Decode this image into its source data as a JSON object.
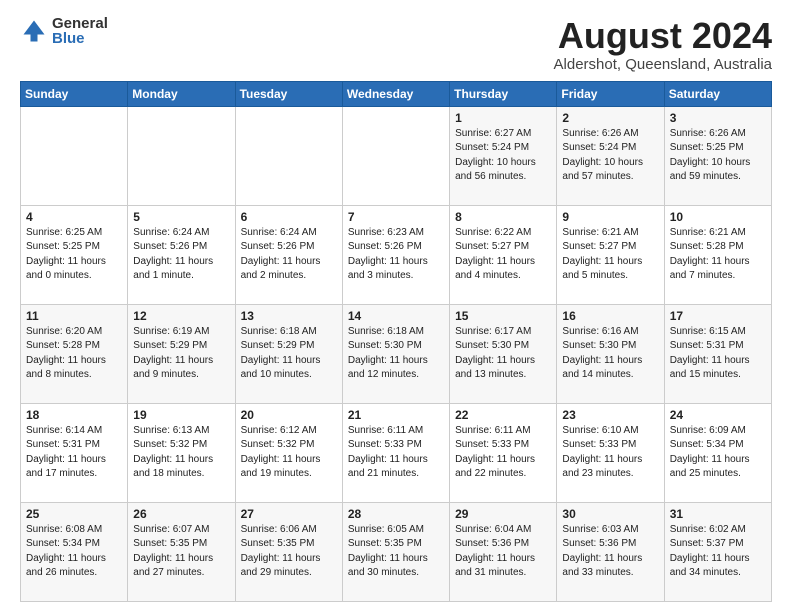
{
  "logo": {
    "general": "General",
    "blue": "Blue"
  },
  "header": {
    "month": "August 2024",
    "location": "Aldershot, Queensland, Australia"
  },
  "weekdays": [
    "Sunday",
    "Monday",
    "Tuesday",
    "Wednesday",
    "Thursday",
    "Friday",
    "Saturday"
  ],
  "rows": [
    [
      {
        "day": "",
        "info": ""
      },
      {
        "day": "",
        "info": ""
      },
      {
        "day": "",
        "info": ""
      },
      {
        "day": "",
        "info": ""
      },
      {
        "day": "1",
        "info": "Sunrise: 6:27 AM\nSunset: 5:24 PM\nDaylight: 10 hours\nand 56 minutes."
      },
      {
        "day": "2",
        "info": "Sunrise: 6:26 AM\nSunset: 5:24 PM\nDaylight: 10 hours\nand 57 minutes."
      },
      {
        "day": "3",
        "info": "Sunrise: 6:26 AM\nSunset: 5:25 PM\nDaylight: 10 hours\nand 59 minutes."
      }
    ],
    [
      {
        "day": "4",
        "info": "Sunrise: 6:25 AM\nSunset: 5:25 PM\nDaylight: 11 hours\nand 0 minutes."
      },
      {
        "day": "5",
        "info": "Sunrise: 6:24 AM\nSunset: 5:26 PM\nDaylight: 11 hours\nand 1 minute."
      },
      {
        "day": "6",
        "info": "Sunrise: 6:24 AM\nSunset: 5:26 PM\nDaylight: 11 hours\nand 2 minutes."
      },
      {
        "day": "7",
        "info": "Sunrise: 6:23 AM\nSunset: 5:26 PM\nDaylight: 11 hours\nand 3 minutes."
      },
      {
        "day": "8",
        "info": "Sunrise: 6:22 AM\nSunset: 5:27 PM\nDaylight: 11 hours\nand 4 minutes."
      },
      {
        "day": "9",
        "info": "Sunrise: 6:21 AM\nSunset: 5:27 PM\nDaylight: 11 hours\nand 5 minutes."
      },
      {
        "day": "10",
        "info": "Sunrise: 6:21 AM\nSunset: 5:28 PM\nDaylight: 11 hours\nand 7 minutes."
      }
    ],
    [
      {
        "day": "11",
        "info": "Sunrise: 6:20 AM\nSunset: 5:28 PM\nDaylight: 11 hours\nand 8 minutes."
      },
      {
        "day": "12",
        "info": "Sunrise: 6:19 AM\nSunset: 5:29 PM\nDaylight: 11 hours\nand 9 minutes."
      },
      {
        "day": "13",
        "info": "Sunrise: 6:18 AM\nSunset: 5:29 PM\nDaylight: 11 hours\nand 10 minutes."
      },
      {
        "day": "14",
        "info": "Sunrise: 6:18 AM\nSunset: 5:30 PM\nDaylight: 11 hours\nand 12 minutes."
      },
      {
        "day": "15",
        "info": "Sunrise: 6:17 AM\nSunset: 5:30 PM\nDaylight: 11 hours\nand 13 minutes."
      },
      {
        "day": "16",
        "info": "Sunrise: 6:16 AM\nSunset: 5:30 PM\nDaylight: 11 hours\nand 14 minutes."
      },
      {
        "day": "17",
        "info": "Sunrise: 6:15 AM\nSunset: 5:31 PM\nDaylight: 11 hours\nand 15 minutes."
      }
    ],
    [
      {
        "day": "18",
        "info": "Sunrise: 6:14 AM\nSunset: 5:31 PM\nDaylight: 11 hours\nand 17 minutes."
      },
      {
        "day": "19",
        "info": "Sunrise: 6:13 AM\nSunset: 5:32 PM\nDaylight: 11 hours\nand 18 minutes."
      },
      {
        "day": "20",
        "info": "Sunrise: 6:12 AM\nSunset: 5:32 PM\nDaylight: 11 hours\nand 19 minutes."
      },
      {
        "day": "21",
        "info": "Sunrise: 6:11 AM\nSunset: 5:33 PM\nDaylight: 11 hours\nand 21 minutes."
      },
      {
        "day": "22",
        "info": "Sunrise: 6:11 AM\nSunset: 5:33 PM\nDaylight: 11 hours\nand 22 minutes."
      },
      {
        "day": "23",
        "info": "Sunrise: 6:10 AM\nSunset: 5:33 PM\nDaylight: 11 hours\nand 23 minutes."
      },
      {
        "day": "24",
        "info": "Sunrise: 6:09 AM\nSunset: 5:34 PM\nDaylight: 11 hours\nand 25 minutes."
      }
    ],
    [
      {
        "day": "25",
        "info": "Sunrise: 6:08 AM\nSunset: 5:34 PM\nDaylight: 11 hours\nand 26 minutes."
      },
      {
        "day": "26",
        "info": "Sunrise: 6:07 AM\nSunset: 5:35 PM\nDaylight: 11 hours\nand 27 minutes."
      },
      {
        "day": "27",
        "info": "Sunrise: 6:06 AM\nSunset: 5:35 PM\nDaylight: 11 hours\nand 29 minutes."
      },
      {
        "day": "28",
        "info": "Sunrise: 6:05 AM\nSunset: 5:35 PM\nDaylight: 11 hours\nand 30 minutes."
      },
      {
        "day": "29",
        "info": "Sunrise: 6:04 AM\nSunset: 5:36 PM\nDaylight: 11 hours\nand 31 minutes."
      },
      {
        "day": "30",
        "info": "Sunrise: 6:03 AM\nSunset: 5:36 PM\nDaylight: 11 hours\nand 33 minutes."
      },
      {
        "day": "31",
        "info": "Sunrise: 6:02 AM\nSunset: 5:37 PM\nDaylight: 11 hours\nand 34 minutes."
      }
    ]
  ]
}
